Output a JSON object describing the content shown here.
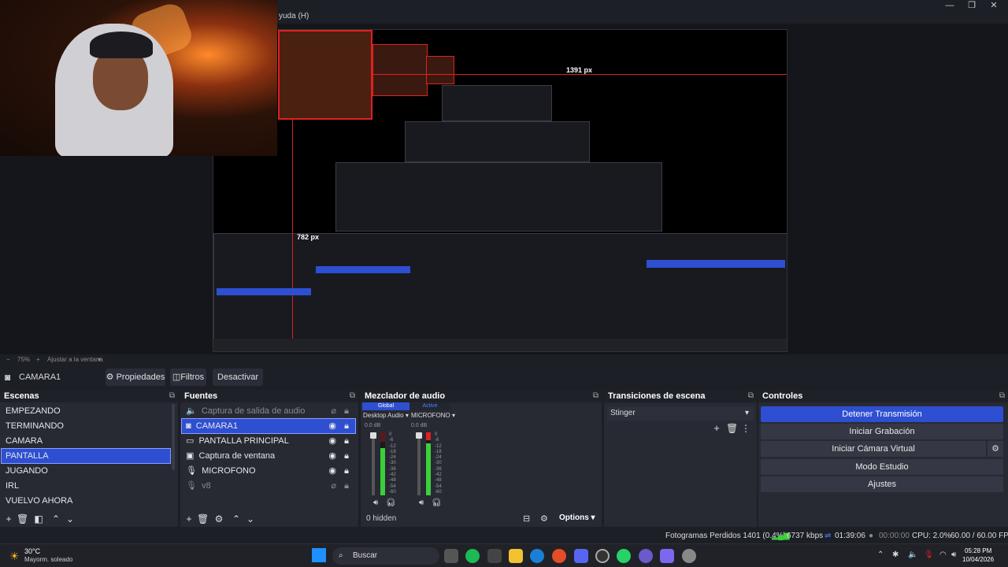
{
  "window": {
    "menu_fragment": "yuda (H)",
    "minimize": "—",
    "maximize": "❐",
    "close": "✕"
  },
  "preview": {
    "measure_h": "1391 px",
    "measure_v": "782 px",
    "footer_zoom": "75%",
    "footer_fit": "Ajustar a la ventana"
  },
  "source_bar": {
    "source_name": "CAMARA1",
    "properties_label": "Propiedades",
    "filters_label": "Filtros",
    "deactivate_label": "Desactivar"
  },
  "scenes": {
    "title": "Escenas",
    "items": [
      "EMPEZANDO",
      "TERMINANDO",
      "CAMARA",
      "PANTALLA",
      "JUGANDO",
      "IRL",
      "VUELVO AHORA"
    ],
    "selected": "PANTALLA"
  },
  "sources": {
    "title": "Fuentes",
    "items": [
      {
        "label": "Captura de salida de audio",
        "icon": "speaker-icon",
        "visible": false
      },
      {
        "label": "CAMARA1",
        "icon": "camera-icon",
        "visible": true
      },
      {
        "label": "PANTALLA PRINCIPAL",
        "icon": "monitor-icon",
        "visible": true
      },
      {
        "label": "Captura de ventana",
        "icon": "window-icon",
        "visible": true
      },
      {
        "label": "MICROFONO",
        "icon": "mic-icon",
        "visible": true
      },
      {
        "label": "v8",
        "icon": "mic-icon",
        "visible": false
      }
    ],
    "selected": "CAMARA1"
  },
  "mixer": {
    "title": "Mezclador de audio",
    "global_tab": "Global",
    "active_tab": "Active",
    "channels": [
      {
        "name": "Desktop Audio",
        "db": "0.0 dB"
      },
      {
        "name": "MICROFONO",
        "db": "0.0 dB"
      }
    ],
    "scale": [
      "0",
      "-6",
      "-12",
      "-18",
      "-24",
      "-30",
      "-36",
      "-42",
      "-48",
      "-54",
      "-60"
    ],
    "hidden_label": "0 hidden",
    "options_label": "Options"
  },
  "transitions": {
    "title": "Transiciones de escena",
    "selected": "Stinger"
  },
  "controls": {
    "title": "Controles",
    "stop_stream": "Detener Transmisión",
    "start_recording": "Iniciar Grabación",
    "virtual_cam": "Iniciar Cámara Virtual",
    "studio_mode": "Modo Estudio",
    "settings": "Ajustes"
  },
  "status": {
    "dropped_frames": "Fotogramas Perdidos 1401 (0.4%)",
    "bitrate": "6737 kbps",
    "stream_time": "01:39:06",
    "record_time": "00:00:00",
    "cpu": "CPU: 2.0%",
    "fps": "60.00 / 60.00 FPS"
  },
  "taskbar": {
    "weather_temp": "30°C",
    "weather_desc": "Mayorm. soleado",
    "search_label": "Buscar",
    "time": "05:28 PM",
    "date": "10/04/2026"
  },
  "colors": {
    "accent": "#2e4fd2",
    "dock_bg": "#272a33",
    "header_bg": "#1f2129",
    "meter_green": "#3ccf3c",
    "meter_red": "#e02020"
  }
}
